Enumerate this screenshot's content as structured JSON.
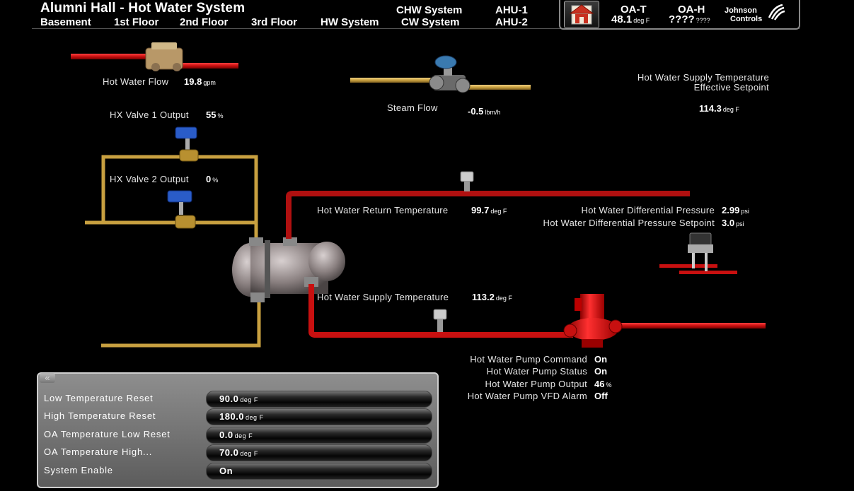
{
  "header": {
    "title": "Alumni Hall - Hot Water System",
    "nav": [
      "Basement",
      "1st Floor",
      "2nd Floor",
      "3rd Floor",
      "HW System"
    ],
    "systems": [
      "CHW System",
      "CW System",
      "AHU-1",
      "AHU-2"
    ],
    "oa_t": {
      "label": "OA-T",
      "value": "48.1",
      "unit": "deg F"
    },
    "oa_h": {
      "label": "OA-H",
      "value": "????",
      "unit": "????"
    },
    "brand": [
      "Johnson",
      "Controls"
    ]
  },
  "points": {
    "hw_flow": {
      "label": "Hot Water Flow",
      "value": "19.8",
      "unit": "gpm"
    },
    "hx_valve_1": {
      "label": "HX Valve 1 Output",
      "value": "55",
      "unit": "%"
    },
    "hx_valve_2": {
      "label": "HX Valve 2 Output",
      "value": "0",
      "unit": "%"
    },
    "steam_flow": {
      "label": "Steam Flow",
      "value": "-0.5",
      "unit": "lbm/h"
    },
    "hws_setpoint": {
      "label_1": "Hot Water Supply Temperature",
      "label_2": "Effective Setpoint",
      "value": "114.3",
      "unit": "deg F"
    },
    "hwr_temp": {
      "label": "Hot Water Return Temperature",
      "value": "99.7",
      "unit": "deg F"
    },
    "hw_dp": {
      "label": "Hot Water Differential Pressure",
      "value": "2.99",
      "unit": "psi"
    },
    "hw_dp_sp": {
      "label": "Hot Water Differential Pressure Setpoint",
      "value": "3.0",
      "unit": "psi"
    },
    "hws_temp": {
      "label": "Hot Water Supply Temperature",
      "value": "113.2",
      "unit": "deg F"
    },
    "pump_cmd": {
      "label": "Hot Water Pump Command",
      "value": "On"
    },
    "pump_status": {
      "label": "Hot Water Pump Status",
      "value": "On"
    },
    "pump_output": {
      "label": "Hot Water Pump Output",
      "value": "46",
      "unit": "%"
    },
    "pump_alarm": {
      "label": "Hot Water Pump VFD Alarm",
      "value": "Off"
    }
  },
  "panel": {
    "collapse": "«",
    "rows": [
      {
        "label": "Low Temperature Reset",
        "value": "90.0",
        "unit": "deg F"
      },
      {
        "label": "High Temperature Reset",
        "value": "180.0",
        "unit": "deg F"
      },
      {
        "label": "OA Temperature Low Reset",
        "value": "0.0",
        "unit": "deg F"
      },
      {
        "label": "OA Temperature High...",
        "value": "70.0",
        "unit": "deg F"
      },
      {
        "label": "System Enable",
        "value": "On",
        "unit": ""
      }
    ]
  },
  "colors": {
    "hot_water": "#c81010",
    "steam_pipe": "#c8a040",
    "pump": "#d01818"
  }
}
